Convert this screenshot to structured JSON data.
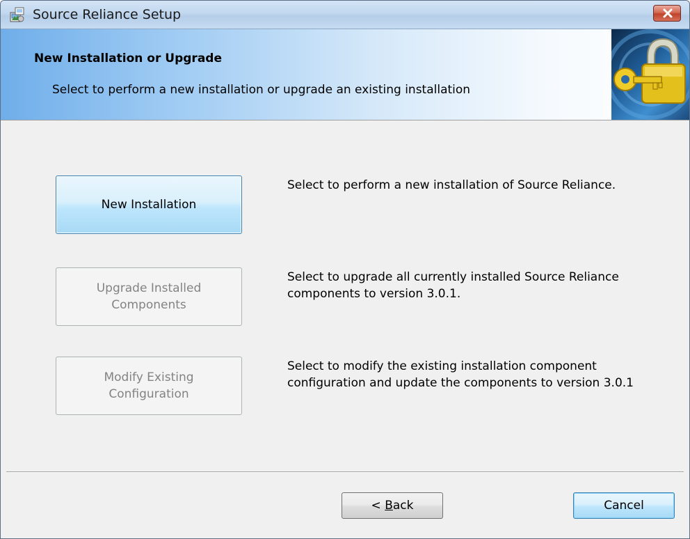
{
  "window": {
    "title": "Source Reliance Setup"
  },
  "icons": {
    "app": "installer-icon",
    "close": "close-icon",
    "banner": "padlock-key-icon"
  },
  "banner": {
    "title": "New Installation or Upgrade",
    "subtitle": "Select to perform a new installation or upgrade an existing installation"
  },
  "options": [
    {
      "label_line1": "New Installation",
      "label_line2": "",
      "description": "Select to perform a new installation of Source Reliance.",
      "enabled": true
    },
    {
      "label_line1": "Upgrade Installed",
      "label_line2": "Components",
      "description": "Select to upgrade all currently installed Source Reliance components to version 3.0.1.",
      "enabled": false
    },
    {
      "label_line1": "Modify Existing",
      "label_line2": "Configuration",
      "description": "Select to modify the existing installation component configuration and update the components to version 3.0.1",
      "enabled": false
    }
  ],
  "footer": {
    "back_prefix": "< ",
    "back_mnemonic": "B",
    "back_rest": "ack",
    "cancel_label": "Cancel"
  },
  "colors": {
    "close_button": "#c0432c",
    "focus_button_border": "#3c7fb1",
    "disabled_text": "#838383"
  }
}
